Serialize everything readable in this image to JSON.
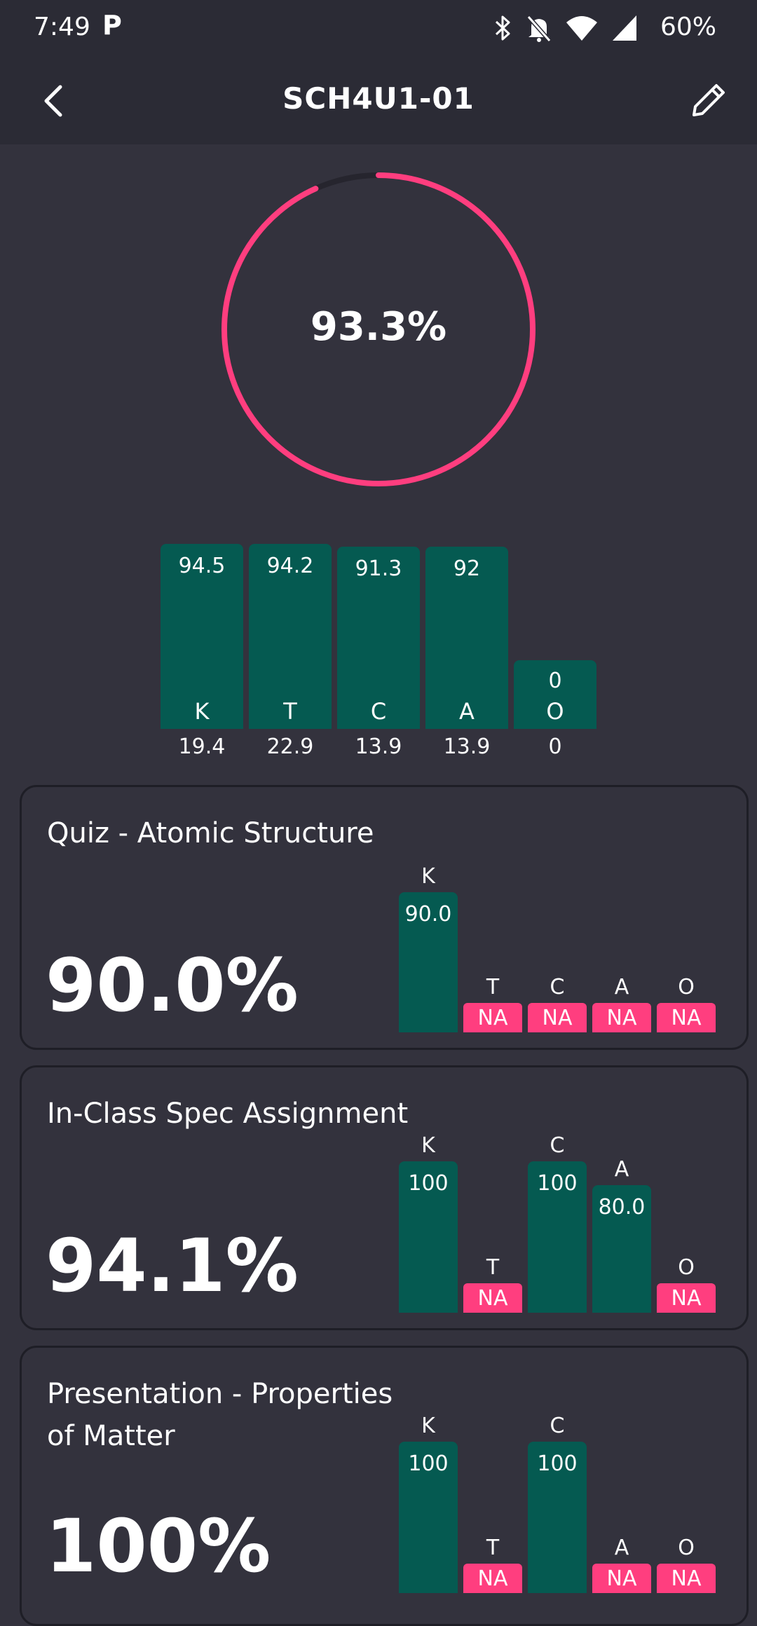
{
  "status_bar": {
    "time": "7:49",
    "app_icon": "P",
    "icons": [
      "bluetooth-icon",
      "bell-off-icon",
      "wifi-icon",
      "signal-icon"
    ],
    "battery": "60%"
  },
  "app_bar": {
    "title": "SCH4U1-01",
    "back_icon": "chevron-left-icon",
    "edit_icon": "pencil-icon"
  },
  "overall": {
    "value_text": "93.3%",
    "progress": 0.933,
    "colors": {
      "ring": "#ff3e7f",
      "track": "#26252e"
    }
  },
  "category_summary": [
    {
      "label": "K",
      "value": "94.5",
      "weight": "19.4"
    },
    {
      "label": "T",
      "value": "94.2",
      "weight": "22.9"
    },
    {
      "label": "C",
      "value": "91.3",
      "weight": "13.9"
    },
    {
      "label": "A",
      "value": "92",
      "weight": "13.9"
    },
    {
      "label": "O",
      "value": "0",
      "weight": "0"
    }
  ],
  "assessments": [
    {
      "title": "Quiz - Atomic Structure",
      "grade": "90.0%",
      "marks": [
        {
          "label": "K",
          "value": "90.0"
        },
        {
          "label": "T",
          "value": "NA"
        },
        {
          "label": "C",
          "value": "NA"
        },
        {
          "label": "A",
          "value": "NA"
        },
        {
          "label": "O",
          "value": "NA"
        }
      ]
    },
    {
      "title": "In-Class Spec Assignment",
      "grade": "94.1%",
      "marks": [
        {
          "label": "K",
          "value": "100"
        },
        {
          "label": "T",
          "value": "NA"
        },
        {
          "label": "C",
          "value": "100"
        },
        {
          "label": "A",
          "value": "80.0"
        },
        {
          "label": "O",
          "value": "NA"
        }
      ]
    },
    {
      "title": "Presentation - Properties of Matter",
      "grade": "100%",
      "marks": [
        {
          "label": "K",
          "value": "100"
        },
        {
          "label": "T",
          "value": "NA"
        },
        {
          "label": "C",
          "value": "100"
        },
        {
          "label": "A",
          "value": "NA"
        },
        {
          "label": "O",
          "value": "NA"
        }
      ]
    }
  ],
  "colors": {
    "bar": "#055a51",
    "na": "#ff3e7f",
    "background": "#33323d"
  }
}
